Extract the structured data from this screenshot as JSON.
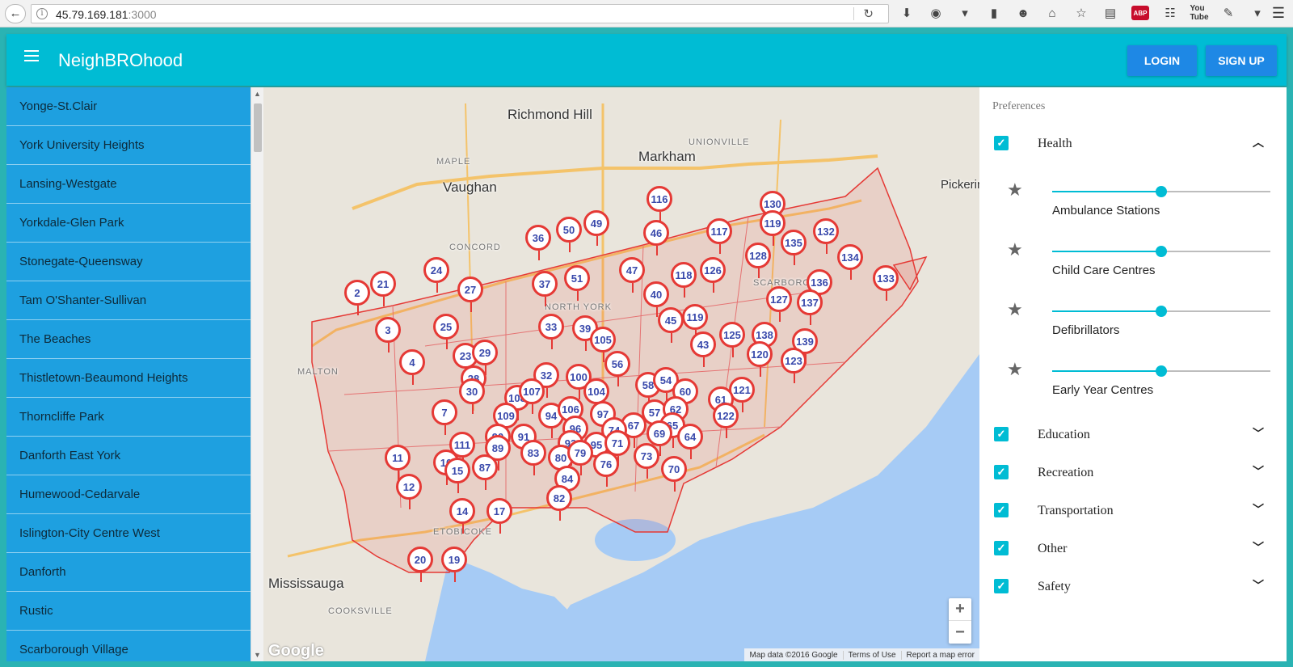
{
  "browser": {
    "url_host": "45.79.169.181",
    "url_port": ":3000",
    "abp_label": "ABP",
    "yt_label": "You Tube"
  },
  "header": {
    "title": "NeighBROhood",
    "login_label": "LOGIN",
    "signup_label": "SIGN UP",
    "color": "#00bcd4"
  },
  "sidebar": {
    "items": [
      "Yonge-St.Clair",
      "York University Heights",
      "Lansing-Westgate",
      "Yorkdale-Glen Park",
      "Stonegate-Queensway",
      "Tam O'Shanter-Sullivan",
      "The Beaches",
      "Thistletown-Beaumond Heights",
      "Thorncliffe Park",
      "Danforth East York",
      "Humewood-Cedarvale",
      "Islington-City Centre West",
      "Danforth",
      "Rustic",
      "Scarborough Village"
    ]
  },
  "map": {
    "places": {
      "richmond_hill": "Richmond Hill",
      "vaughan": "Vaughan",
      "markham": "Markham",
      "pickering": "Pickerin",
      "mississauga": "Mississauga",
      "north_york": "NORTH YORK",
      "scarborough": "SCARBOROU",
      "etobicoke": "ETOBICOKE",
      "malton": "MALTON",
      "concord": "CONCORD",
      "maple": "MAPLE",
      "unionville": "UNIONVILLE",
      "cooksville": "COOKSVILLE"
    },
    "google_logo": "Google",
    "attribution": [
      "Map data ©2016 Google",
      "Terms of Use",
      "Report a map error"
    ],
    "zoom_in": "+",
    "zoom_out": "−",
    "markers": [
      "116",
      "130",
      "49",
      "50",
      "36",
      "46",
      "117",
      "119",
      "132",
      "135",
      "134",
      "24",
      "21",
      "2",
      "27",
      "37",
      "51",
      "47",
      "118",
      "126",
      "128",
      "136",
      "133",
      "40",
      "127",
      "137",
      "3",
      "25",
      "33",
      "39",
      "45",
      "119",
      "138",
      "139",
      "4",
      "23",
      "29",
      "105",
      "56",
      "43",
      "125",
      "120",
      "123",
      "28",
      "32",
      "100",
      "58",
      "54",
      "60",
      "121",
      "30",
      "108",
      "107",
      "104",
      "57",
      "62",
      "61",
      "122",
      "7",
      "109",
      "94",
      "106",
      "97",
      "67",
      "65",
      "96",
      "74",
      "69",
      "64",
      "111",
      "90",
      "89",
      "91",
      "83",
      "93",
      "95",
      "71",
      "11",
      "10",
      "15",
      "87",
      "80",
      "79",
      "76",
      "73",
      "70",
      "12",
      "84",
      "82",
      "14",
      "17",
      "20",
      "19"
    ]
  },
  "preferences": {
    "title": "Preferences",
    "categories": [
      {
        "label": "Health",
        "checked": true,
        "expanded": true
      },
      {
        "label": "Education",
        "checked": true,
        "expanded": false
      },
      {
        "label": "Recreation",
        "checked": true,
        "expanded": false
      },
      {
        "label": "Transportation",
        "checked": true,
        "expanded": false
      },
      {
        "label": "Other",
        "checked": true,
        "expanded": false
      },
      {
        "label": "Safety",
        "checked": true,
        "expanded": false
      }
    ],
    "health_items": [
      {
        "label": "Ambulance Stations",
        "value": 0.5
      },
      {
        "label": "Child Care Centres",
        "value": 0.5
      },
      {
        "label": "Defibrillators",
        "value": 0.5
      },
      {
        "label": "Early Year Centres",
        "value": 0.5
      }
    ]
  }
}
